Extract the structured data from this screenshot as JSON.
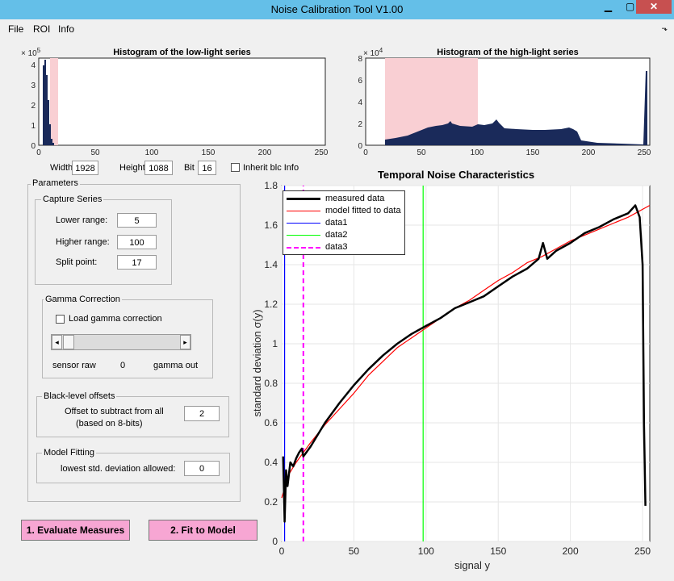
{
  "window": {
    "title": "Noise Calibration Tool V1.00",
    "minimize": "▁",
    "maximize": "▢",
    "close": "✕"
  },
  "menu": [
    "File",
    "ROI",
    "Info"
  ],
  "dock_icon": "⬎",
  "hist_low": {
    "title": "Histogram of the low-light series",
    "exponent": "×10^5",
    "exponent_base": "× 10",
    "exponent_power": "5",
    "yticks": [
      "0",
      "1",
      "2",
      "3",
      "4"
    ],
    "xticks": [
      "0",
      "50",
      "100",
      "150",
      "200",
      "250"
    ],
    "highlight_range": [
      10,
      17
    ]
  },
  "hist_high": {
    "title": "Histogram of the high-light series",
    "exponent_base": "× 10",
    "exponent_power": "4",
    "yticks": [
      "0",
      "2",
      "4",
      "6",
      "8"
    ],
    "xticks": [
      "0",
      "50",
      "100",
      "150",
      "200",
      "250"
    ],
    "highlight_range": [
      17,
      100
    ]
  },
  "image_params": {
    "width_label": "Width",
    "width_value": "1928",
    "height_label": "Height",
    "height_value": "1088",
    "bit_label": "Bit",
    "bit_value": "16",
    "inherit_label": "Inherit blc Info",
    "inherit_checked": false
  },
  "parameters": {
    "title": "Parameters",
    "capture_series": {
      "title": "Capture Series",
      "lower_label": "Lower range:",
      "lower_value": "5",
      "higher_label": "Higher range:",
      "higher_value": "100",
      "split_label": "Split point:",
      "split_value": "17"
    },
    "gamma": {
      "title": "Gamma Correction",
      "load_label": "Load gamma correction",
      "load_checked": false,
      "left_arrow": "◂",
      "right_arrow": "▸",
      "sensor_raw": "sensor raw",
      "value": "0",
      "gamma_out": "gamma out"
    },
    "black_level": {
      "title": "Black-level offsets",
      "line1": "Offset to subtract from all",
      "line2": "(based on 8-bits)",
      "value": "2"
    },
    "model_fitting": {
      "title": "Model Fitting",
      "label": "lowest std. deviation allowed:",
      "value": "0"
    }
  },
  "buttons": {
    "evaluate": "1. Evaluate Measures",
    "fit": "2. Fit to Model"
  },
  "chart_data": {
    "type": "line",
    "title": "Temporal Noise Characteristics",
    "xlabel": "signal y",
    "ylabel": "standard deviation σ(y)",
    "xlim": [
      0,
      255
    ],
    "ylim": [
      0,
      1.8
    ],
    "xticks": [
      "0",
      "50",
      "100",
      "150",
      "200",
      "250"
    ],
    "yticks": [
      "0",
      "0.2",
      "0.4",
      "0.6",
      "0.8",
      "1",
      "1.2",
      "1.4",
      "1.6",
      "1.8"
    ],
    "grid": true,
    "legend_position": "top-left",
    "series": [
      {
        "name": "measured data",
        "color": "#000000",
        "x": [
          1,
          2,
          3,
          4,
          6,
          8,
          10,
          12,
          14,
          15,
          16,
          20,
          30,
          40,
          50,
          60,
          70,
          80,
          90,
          100,
          110,
          120,
          130,
          140,
          150,
          160,
          170,
          178,
          181,
          184,
          190,
          200,
          210,
          220,
          230,
          240,
          245,
          248,
          250,
          251,
          252
        ],
        "y": [
          0.43,
          0.1,
          0.36,
          0.28,
          0.4,
          0.38,
          0.42,
          0.45,
          0.47,
          0.43,
          0.44,
          0.48,
          0.6,
          0.7,
          0.79,
          0.87,
          0.94,
          1.0,
          1.05,
          1.09,
          1.13,
          1.18,
          1.21,
          1.24,
          1.29,
          1.34,
          1.38,
          1.43,
          1.51,
          1.43,
          1.47,
          1.51,
          1.56,
          1.59,
          1.63,
          1.66,
          1.7,
          1.64,
          1.4,
          0.6,
          0.18
        ]
      },
      {
        "name": "model fitted to data",
        "color": "#ff0000",
        "x": [
          0,
          5,
          10,
          20,
          30,
          40,
          50,
          60,
          70,
          80,
          90,
          100,
          110,
          120,
          130,
          140,
          150,
          160,
          170,
          180,
          190,
          200,
          210,
          220,
          230,
          240,
          250,
          255
        ],
        "y": [
          0.22,
          0.34,
          0.4,
          0.5,
          0.59,
          0.67,
          0.75,
          0.84,
          0.91,
          0.98,
          1.03,
          1.08,
          1.13,
          1.18,
          1.22,
          1.27,
          1.32,
          1.36,
          1.41,
          1.44,
          1.48,
          1.52,
          1.55,
          1.58,
          1.61,
          1.64,
          1.68,
          1.7
        ]
      },
      {
        "name": "data1",
        "color": "#0000ff",
        "x": [
          2,
          2
        ],
        "y": [
          0,
          1.8
        ]
      },
      {
        "name": "data2",
        "color": "#00ff00",
        "x": [
          98,
          98
        ],
        "y": [
          0,
          1.8
        ]
      },
      {
        "name": "data3",
        "color": "#ff00ff",
        "x": [
          15,
          15
        ],
        "y": [
          0,
          1.8
        ]
      }
    ]
  }
}
